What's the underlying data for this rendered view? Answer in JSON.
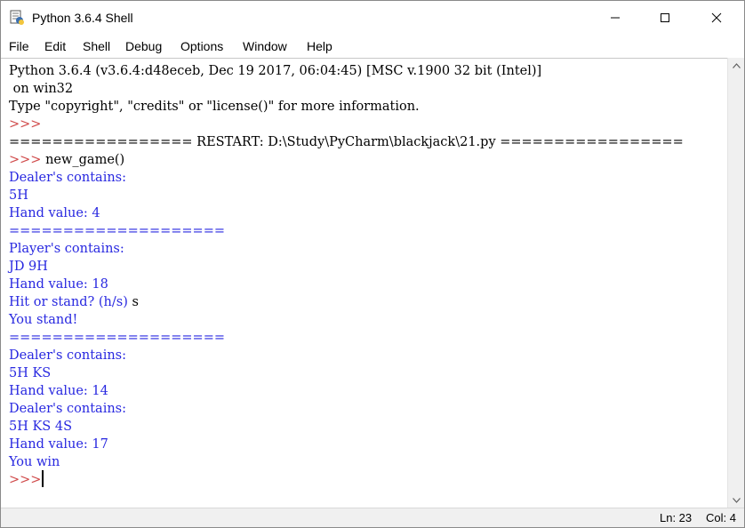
{
  "window": {
    "title": "Python 3.6.4 Shell",
    "minimize_glyph": "—",
    "maximize_glyph": "☐",
    "close_glyph": "✕"
  },
  "menu": {
    "items": [
      "File",
      "Edit",
      "Shell",
      "Debug",
      "Options",
      "Window",
      "Help"
    ]
  },
  "shell": {
    "lines": [
      {
        "text": "Python 3.6.4 (v3.6.4:d48eceb, Dec 19 2017, 06:04:45) [MSC v.1900 32 bit (Intel)]",
        "color": "black"
      },
      {
        "text": " on win32",
        "color": "black"
      },
      {
        "text": "Type \"copyright\", \"credits\" or \"license()\" for more information.",
        "color": "black"
      },
      {
        "text": ">>> ",
        "color": "prompt"
      },
      {
        "text": "================= RESTART: D:\\Study\\PyCharm\\blackjack\\21.py =================",
        "color": "black"
      },
      {
        "prompt": ">>> ",
        "text": "new_game()",
        "color": "black"
      },
      {
        "text": "Dealer's contains:",
        "color": "blue"
      },
      {
        "text": "5H",
        "color": "blue"
      },
      {
        "text": "Hand value: 4",
        "color": "blue"
      },
      {
        "text": "====================",
        "color": "blue"
      },
      {
        "text": "Player's contains:",
        "color": "blue"
      },
      {
        "text": "JD 9H",
        "color": "blue"
      },
      {
        "text": "Hand value: 18",
        "color": "blue"
      },
      {
        "text": "Hit or stand? (h/s) ",
        "color": "blue",
        "input": "s"
      },
      {
        "text": "You stand!",
        "color": "blue"
      },
      {
        "text": "====================",
        "color": "blue"
      },
      {
        "text": "Dealer's contains:",
        "color": "blue"
      },
      {
        "text": "5H KS",
        "color": "blue"
      },
      {
        "text": "Hand value: 14",
        "color": "blue"
      },
      {
        "text": "Dealer's contains:",
        "color": "blue"
      },
      {
        "text": "5H KS 4S",
        "color": "blue"
      },
      {
        "text": "Hand value: 17",
        "color": "blue"
      },
      {
        "text": "You win",
        "color": "blue"
      },
      {
        "text": ">>> ",
        "color": "prompt"
      }
    ]
  },
  "status": {
    "line": "Ln: 23",
    "col": "Col: 4"
  },
  "colors": {
    "prompt": "#d04a4a",
    "output": "#2828e0",
    "text": "#000000"
  }
}
